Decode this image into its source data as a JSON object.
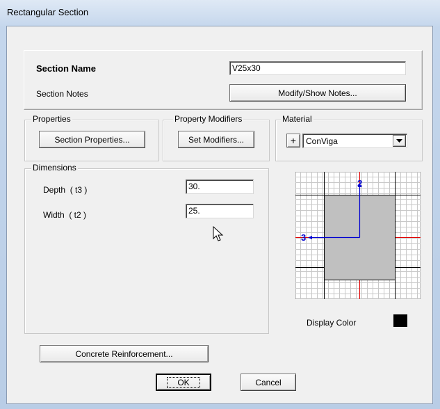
{
  "window": {
    "title": "Rectangular Section"
  },
  "section": {
    "name_label": "Section Name",
    "name_value": "V25x30",
    "notes_label": "Section Notes",
    "notes_button": "Modify/Show Notes..."
  },
  "properties": {
    "group_label": "Properties",
    "button": "Section Properties..."
  },
  "modifiers": {
    "group_label": "Property Modifiers",
    "button": "Set Modifiers..."
  },
  "material": {
    "group_label": "Material",
    "add_button": "+",
    "selected": "ConViga"
  },
  "dimensions": {
    "group_label": "Dimensions",
    "depth_label": "Depth  ( t3 )",
    "depth_value": "30.",
    "width_label": "Width  ( t2 )",
    "width_value": "25."
  },
  "preview": {
    "axis_2": "2",
    "axis_3": "3"
  },
  "display_color": {
    "label": "Display Color",
    "color": "#000000"
  },
  "footer": {
    "reinforcement_button": "Concrete Reinforcement...",
    "ok_button": "OK",
    "cancel_button": "Cancel"
  }
}
